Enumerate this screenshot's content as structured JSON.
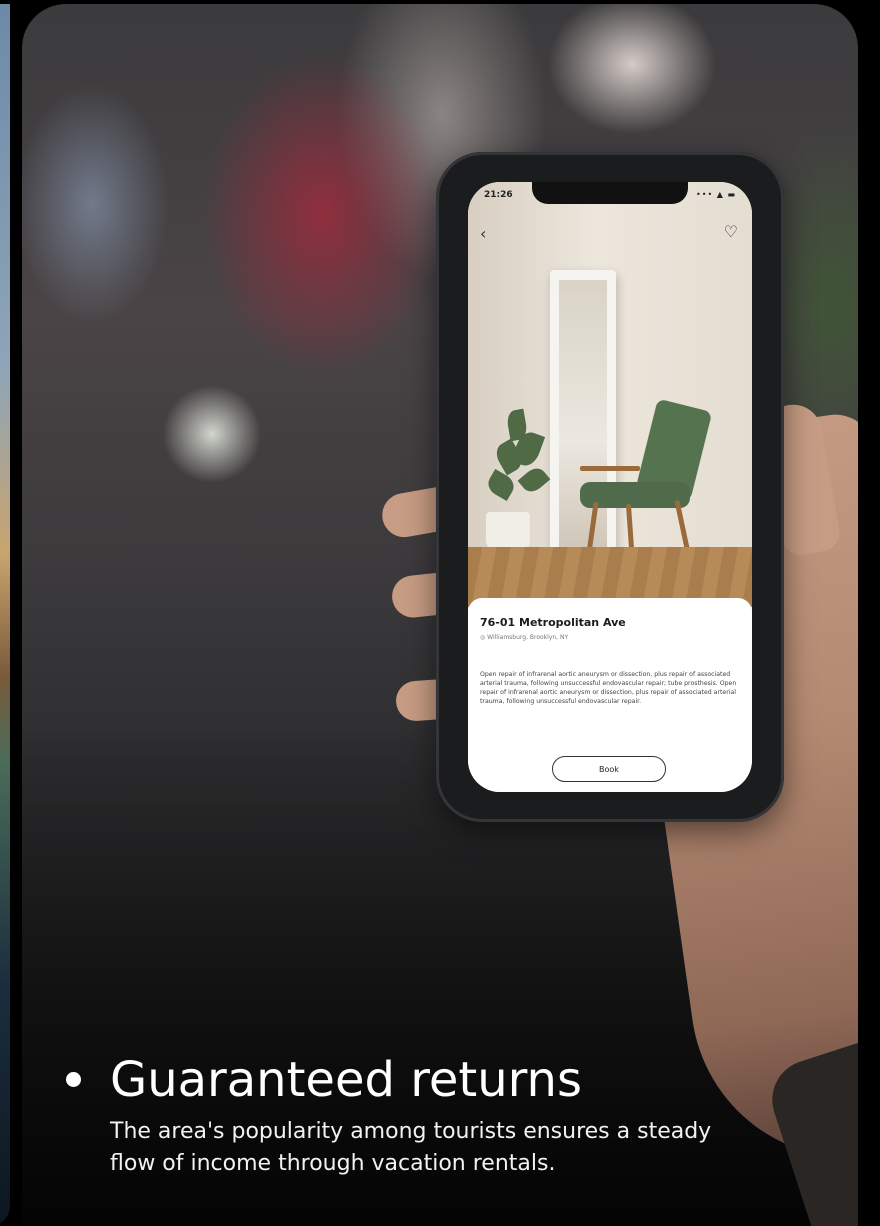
{
  "screen_card": {
    "phone": {
      "status": {
        "time": "21:26",
        "icons": "••• ▲ ▬"
      },
      "icons": {
        "back": "chevron-left-icon",
        "favorite": "heart-icon"
      },
      "listing": {
        "title": "76-01 Metropolitan Ave",
        "location": "Williamsburg, Brooklyn, NY",
        "description": "Open repair of infrarenal aortic aneurysm or dissection, plus repair of associated arterial trauma, following unsuccessful endovascular repair; tube prosthesis. Open repair of infrarenal aortic aneurysm or dissection, plus repair of associated arterial trauma, following unsuccessful endovascular repair.",
        "book_label": "Book"
      }
    },
    "caption": {
      "title": "Guaranteed returns",
      "description": "The area's popularity among tourists ensures a steady flow of income through vacation rentals."
    }
  }
}
